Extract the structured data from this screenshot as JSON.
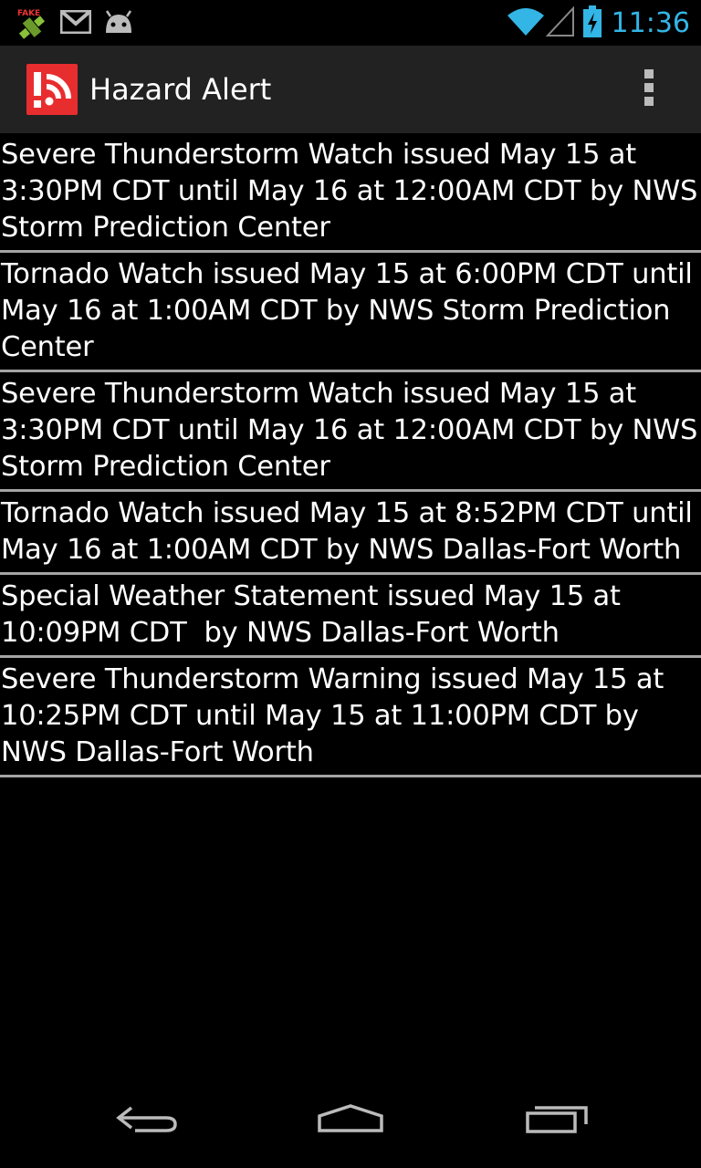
{
  "status_bar": {
    "time": "11:36",
    "fake_label": "FAKE",
    "icons": [
      "gps-fake-icon",
      "gmail-icon",
      "android-debug-icon",
      "wifi-icon",
      "signal-icon",
      "battery-charging-icon"
    ],
    "accent_color": "#33b5e5"
  },
  "action_bar": {
    "title": "Hazard Alert",
    "app_icon": "hazard-alert-icon",
    "overflow_icon": "overflow-menu-icon",
    "icon_color": "#e82d2f"
  },
  "alerts": [
    {
      "text": "Severe Thunderstorm Watch issued May 15 at\n3:30PM CDT until May 16 at 12:00AM CDT by NWS\nStorm Prediction Center"
    },
    {
      "text": "Tornado Watch issued May 15 at 6:00PM CDT until\nMay 16 at 1:00AM CDT by NWS Storm Prediction\nCenter"
    },
    {
      "text": "Severe Thunderstorm Watch issued May 15 at\n3:30PM CDT until May 16 at 12:00AM CDT by NWS\nStorm Prediction Center"
    },
    {
      "text": "Tornado Watch issued May 15 at 8:52PM CDT until\nMay 16 at 1:00AM CDT by NWS Dallas-Fort Worth"
    },
    {
      "text": "Special Weather Statement issued May 15 at\n10:09PM CDT  by NWS Dallas-Fort Worth"
    },
    {
      "text": "Severe Thunderstorm Warning issued May 15 at\n10:25PM CDT until May 15 at 11:00PM CDT by\nNWS Dallas-Fort Worth"
    }
  ],
  "nav_bar": {
    "buttons": [
      "back-icon",
      "home-icon",
      "recent-apps-icon"
    ]
  }
}
